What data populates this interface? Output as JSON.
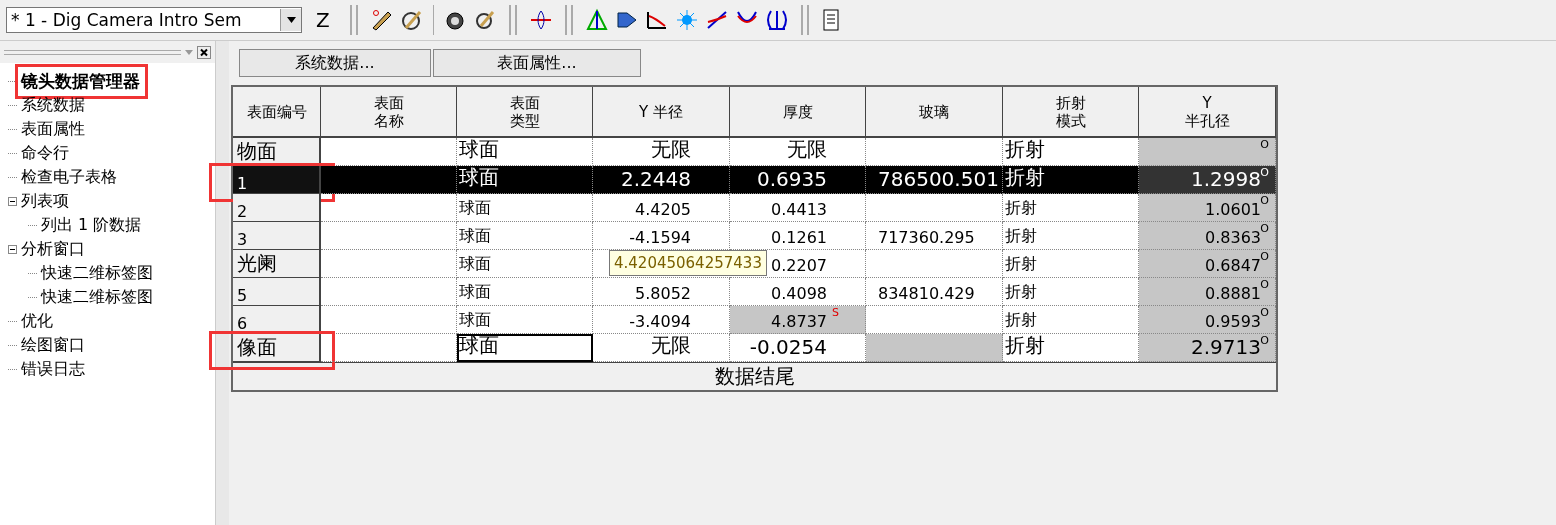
{
  "toolbar": {
    "document": "* 1 - Dig Camera Intro Sem",
    "z_button": "Z"
  },
  "tree": [
    {
      "label": "镜头数据管理器",
      "bold": true,
      "highlighted": true
    },
    {
      "label": "系统数据"
    },
    {
      "label": "表面属性"
    },
    {
      "label": "命令行"
    },
    {
      "label": "检查电子表格"
    },
    {
      "label": "列表项",
      "expanded": true,
      "children": [
        {
          "label": "列出 1 阶数据"
        }
      ]
    },
    {
      "label": "分析窗口",
      "expanded": true,
      "children": [
        {
          "label": "快速二维标签图"
        },
        {
          "label": "快速二维标签图"
        }
      ]
    },
    {
      "label": "优化"
    },
    {
      "label": "绘图窗口"
    },
    {
      "label": "错误日志"
    }
  ],
  "buttons": [
    "系统数据...",
    "表面属性..."
  ],
  "table": {
    "columns": [
      "表面编号",
      "表面名称",
      "表面类型",
      "Y 半径",
      "厚度",
      "玻璃",
      "折射模式",
      "Y\n半孔径"
    ],
    "rows": [
      {
        "selected": false,
        "cells": [
          {
            "text": "物面"
          },
          {},
          {
            "text": "球面"
          },
          {
            "text": "无限"
          },
          {
            "text": "无限"
          },
          {},
          {
            "text": "折射"
          },
          {
            "shaded": true,
            "marker": "O"
          }
        ]
      },
      {
        "selected": true,
        "highlighted": true,
        "cells": [
          {
            "text": "1"
          },
          {},
          {
            "text": "球面"
          },
          {
            "text": "2.2448"
          },
          {
            "text": "0.6935"
          },
          {
            "text": "786500.501"
          },
          {
            "text": "折射"
          },
          {
            "text": "1.2998",
            "shaded": true,
            "marker": "O"
          }
        ]
      },
      {
        "selected": false,
        "cells": [
          {
            "text": "2"
          },
          {},
          {
            "text": "球面"
          },
          {
            "text": "4.4205"
          },
          {
            "text": "0.4413"
          },
          {},
          {
            "text": "折射"
          },
          {
            "text": "1.0601",
            "shaded": true,
            "marker": "O"
          }
        ]
      },
      {
        "selected": false,
        "cells": [
          {
            "text": "3"
          },
          {},
          {
            "text": "球面"
          },
          {
            "text": "-4.1594"
          },
          {
            "text": "0.1261"
          },
          {
            "text": "717360.295"
          },
          {
            "text": "折射"
          },
          {
            "text": "0.8363",
            "shaded": true,
            "marker": "O"
          }
        ]
      },
      {
        "selected": false,
        "cells": [
          {
            "text": "光阑"
          },
          {},
          {
            "text": "球面"
          },
          {},
          {
            "text": "0.2207"
          },
          {},
          {
            "text": "折射"
          },
          {
            "text": "0.6847",
            "shaded": true,
            "marker": "O"
          }
        ]
      },
      {
        "selected": false,
        "cells": [
          {
            "text": "5"
          },
          {},
          {
            "text": "球面"
          },
          {
            "text": "5.8052"
          },
          {
            "text": "0.4098"
          },
          {
            "text": "834810.429"
          },
          {
            "text": "折射"
          },
          {
            "text": "0.8881",
            "shaded": true,
            "marker": "O"
          }
        ]
      },
      {
        "selected": false,
        "cells": [
          {
            "text": "6"
          },
          {},
          {
            "text": "球面"
          },
          {
            "text": "-3.4094"
          },
          {
            "text": "4.8737",
            "shaded": true,
            "marker": "S"
          },
          {},
          {
            "text": "折射"
          },
          {
            "text": "0.9593",
            "shaded": true,
            "marker": "O"
          }
        ]
      },
      {
        "selected": false,
        "highlighted": true,
        "cells": [
          {
            "text": "像面"
          },
          {},
          {
            "text": "球面",
            "focused": true
          },
          {
            "text": "无限"
          },
          {
            "text": "-0.0254"
          },
          {
            "shaded": true
          },
          {
            "text": "折射"
          },
          {
            "text": "2.9713",
            "shaded": true,
            "marker": "O"
          }
        ]
      }
    ],
    "footer": "数据结尾",
    "tooltip": "4.42045064257433"
  }
}
